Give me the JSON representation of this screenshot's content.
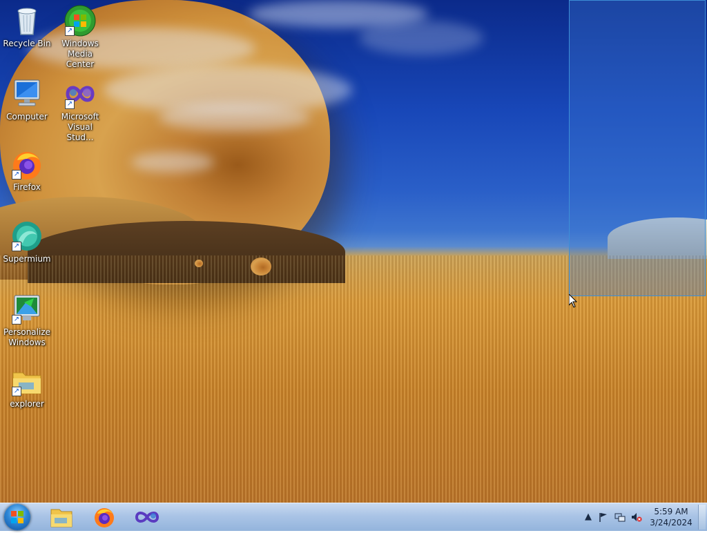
{
  "desktop": {
    "icons": [
      {
        "label": "Recycle Bin",
        "icon": "recycle-bin-icon",
        "shortcut": false
      },
      {
        "label": "Windows\nMedia Center",
        "icon": "windows-media-center-icon",
        "shortcut": true
      },
      {
        "label": "Computer",
        "icon": "computer-icon",
        "shortcut": false
      },
      {
        "label": "Microsoft\nVisual Stud...",
        "icon": "visual-studio-icon",
        "shortcut": true
      },
      {
        "label": "Firefox",
        "icon": "firefox-icon",
        "shortcut": true
      },
      {
        "label": "Supermium",
        "icon": "supermium-icon",
        "shortcut": true
      },
      {
        "label": "Personalize\nWindows",
        "icon": "personalize-icon",
        "shortcut": true
      },
      {
        "label": "explorer",
        "icon": "folder-icon",
        "shortcut": true
      }
    ]
  },
  "taskbar": {
    "start": "start-button",
    "pinned": [
      "file-explorer",
      "firefox",
      "visual-studio"
    ],
    "tray": {
      "icons": [
        "show-hidden-icons",
        "action-center-flag",
        "network",
        "volume-muted"
      ],
      "time": "5:59 AM",
      "date": "3/24/2024"
    }
  },
  "colors": {
    "selection_border": "#3d8fd6",
    "taskbar": "#aac4e6"
  }
}
